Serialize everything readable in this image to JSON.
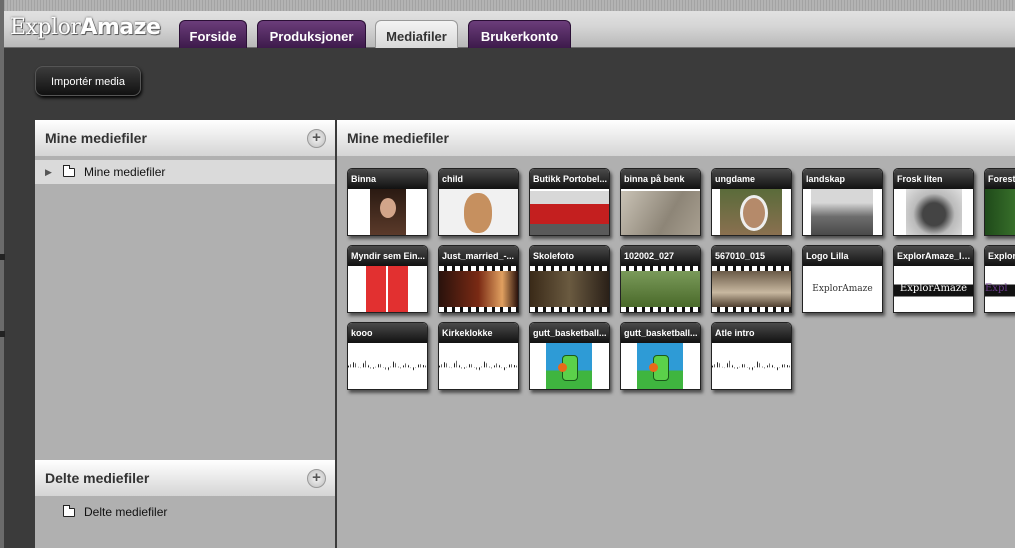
{
  "app": {
    "logo_light": "Explor",
    "logo_bold": "Amaze"
  },
  "nav": {
    "tabs": [
      {
        "label": "Forside",
        "active": false
      },
      {
        "label": "Produksjoner",
        "active": false
      },
      {
        "label": "Mediafiler",
        "active": true
      },
      {
        "label": "Brukerkonto",
        "active": false
      }
    ]
  },
  "toolbar": {
    "import_label": "Importér media"
  },
  "sidebar": {
    "my_files": {
      "title": "Mine mediefiler",
      "tree_item": "Mine mediefiler"
    },
    "shared_files": {
      "title": "Delte mediefiler",
      "tree_item": "Delte mediefiler"
    },
    "add_icon": "plus-icon"
  },
  "main": {
    "title": "Mine mediefiler",
    "media": [
      {
        "title": "Binna",
        "kind": "image",
        "thumb": "portrait"
      },
      {
        "title": "child",
        "kind": "image",
        "thumb": "child"
      },
      {
        "title": "Butikk Portobel...",
        "kind": "image",
        "thumb": "shop"
      },
      {
        "title": "binna på benk",
        "kind": "image",
        "thumb": "bench"
      },
      {
        "title": "ungdame",
        "kind": "image",
        "thumb": "woman"
      },
      {
        "title": "landskap",
        "kind": "image",
        "thumb": "landscape"
      },
      {
        "title": "Frosk liten",
        "kind": "image",
        "thumb": "frog"
      },
      {
        "title": "Forest",
        "kind": "image",
        "thumb": "forest"
      },
      {
        "title": "Myndir sem Ein...",
        "kind": "image",
        "thumb": "red"
      },
      {
        "title": "Just_married_-...",
        "kind": "video",
        "thumb": "wedding"
      },
      {
        "title": "Skolefoto",
        "kind": "video",
        "thumb": "school"
      },
      {
        "title": "102002_027",
        "kind": "video",
        "thumb": "grass"
      },
      {
        "title": "567010_015",
        "kind": "video",
        "thumb": "hand"
      },
      {
        "title": "Logo Lilla",
        "kind": "image",
        "thumb": "logo",
        "logo_text": "ExplorAmaze"
      },
      {
        "title": "ExplorAmaze_lo...",
        "kind": "image",
        "thumb": "logo-dark",
        "logo_text": "ExplorAmaze"
      },
      {
        "title": "ExplorF",
        "kind": "image",
        "thumb": "logo-dark2",
        "logo_text": "Expl"
      },
      {
        "title": "kooo",
        "kind": "audio",
        "thumb": "wave"
      },
      {
        "title": "Kirkeklokke",
        "kind": "audio",
        "thumb": "wave"
      },
      {
        "title": "gutt_basketball...",
        "kind": "image",
        "thumb": "basketball"
      },
      {
        "title": "gutt_basketball...",
        "kind": "image",
        "thumb": "basketball"
      },
      {
        "title": "Atle intro",
        "kind": "audio",
        "thumb": "wave"
      }
    ]
  }
}
